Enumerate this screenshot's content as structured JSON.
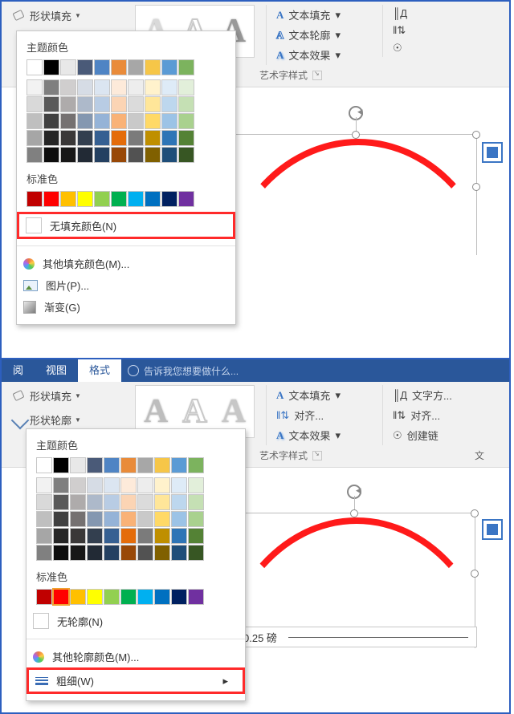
{
  "top": {
    "shapeFill": "形状填充",
    "textFill": "文本填充",
    "textOutline": "文本轮廓",
    "textEffect": "文本效果",
    "groupLabel": "艺术字样式",
    "popup": {
      "themeHeader": "主题颜色",
      "standardHeader": "标准色",
      "noFill": "无填充颜色(N)",
      "moreColors": "其他填充颜色(M)...",
      "picture": "图片(P)...",
      "gradient": "渐变(G)"
    }
  },
  "bottom": {
    "tabs": {
      "left": "阅",
      "view": "视图",
      "format": "格式",
      "tell": "告诉我您想要做什么..."
    },
    "shapeFill": "形状填充",
    "shapeOutline": "形状轮廓",
    "textFill": "文本填充",
    "textOutline": "文字方...",
    "alignText": "对齐...",
    "textEffect": "文本效果",
    "createLink": "创建链",
    "groupLabel": "艺术字样式",
    "groupLabel2": "文",
    "popup": {
      "themeHeader": "主题颜色",
      "standardHeader": "标准色",
      "noOutline": "无轮廓(N)",
      "moreColors": "其他轮廓颜色(M)...",
      "weight": "粗细(W)"
    },
    "weightSample": "0.25 磅"
  },
  "themeRow1": [
    "#ffffff",
    "#000000",
    "#e8e8e8",
    "#4a5a78",
    "#4f84c4",
    "#e98b3a",
    "#a7a7a7",
    "#f6c648",
    "#5b9bd5",
    "#7cb35e"
  ],
  "themeRows": [
    [
      "#f2f2f2",
      "#7f7f7f",
      "#d0cece",
      "#d6dce5",
      "#dbe5f1",
      "#fdeada",
      "#ededed",
      "#fff2cc",
      "#deebf7",
      "#e2efda"
    ],
    [
      "#d9d9d9",
      "#595959",
      "#aeabab",
      "#adb9ca",
      "#b8cce4",
      "#fbd4b4",
      "#dbdbdb",
      "#ffe699",
      "#bdd7ee",
      "#c5e0b4"
    ],
    [
      "#bfbfbf",
      "#404040",
      "#757171",
      "#8497b0",
      "#95b3d7",
      "#f9b277",
      "#c9c9c9",
      "#ffd966",
      "#9cc3e6",
      "#a9d18e"
    ],
    [
      "#a6a6a6",
      "#262626",
      "#3a3838",
      "#333f4f",
      "#366092",
      "#e46c0a",
      "#7b7b7b",
      "#bf8f00",
      "#2e75b6",
      "#548235"
    ],
    [
      "#808080",
      "#0d0d0d",
      "#171717",
      "#222a35",
      "#244061",
      "#984807",
      "#525252",
      "#806000",
      "#1f4e79",
      "#375623"
    ]
  ],
  "standard": [
    "#c00000",
    "#ff0000",
    "#ffc000",
    "#ffff00",
    "#92d050",
    "#00b050",
    "#00b0f0",
    "#0070c0",
    "#002060",
    "#7030a0"
  ]
}
